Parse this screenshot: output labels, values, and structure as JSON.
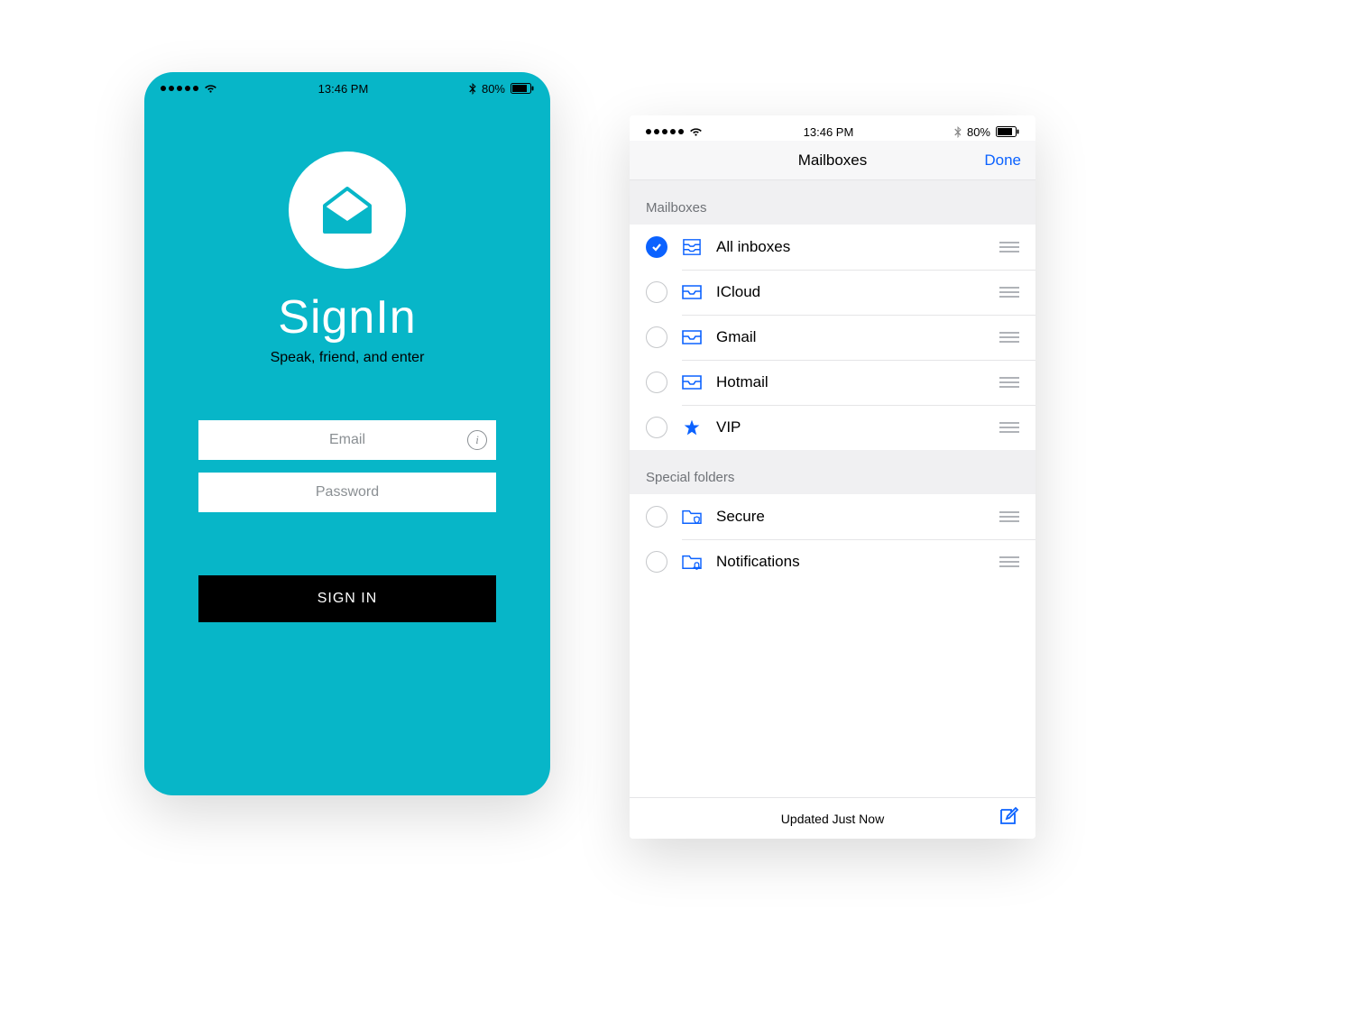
{
  "status": {
    "time": "13:46 PM",
    "battery_pct": "80%"
  },
  "signin": {
    "title": "SignIn",
    "subtitle": "Speak, friend, and enter",
    "email_placeholder": "Email",
    "password_placeholder": "Password",
    "button": "SIGN IN"
  },
  "mail": {
    "nav_title": "Mailboxes",
    "done": "Done",
    "section1": "Mailboxes",
    "section2": "Special folders",
    "rows1": [
      {
        "label": "All inboxes",
        "icon": "inbox-stack",
        "checked": true
      },
      {
        "label": "ICloud",
        "icon": "inbox",
        "checked": false
      },
      {
        "label": "Gmail",
        "icon": "inbox",
        "checked": false
      },
      {
        "label": "Hotmail",
        "icon": "inbox",
        "checked": false
      },
      {
        "label": "VIP",
        "icon": "star",
        "checked": false
      }
    ],
    "rows2": [
      {
        "label": "Secure",
        "icon": "folder-shield",
        "checked": false
      },
      {
        "label": "Notifications",
        "icon": "folder-bell",
        "checked": false
      }
    ],
    "updated": "Updated Just Now"
  }
}
